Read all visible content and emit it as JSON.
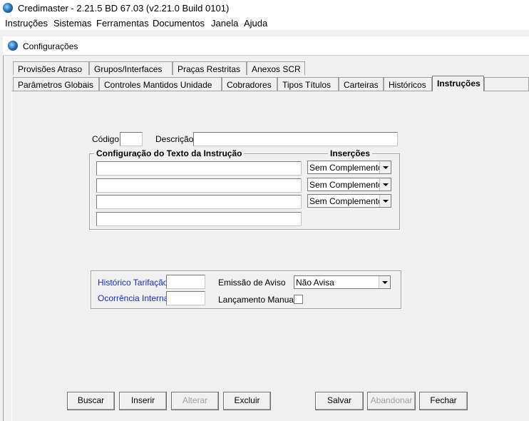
{
  "app": {
    "title": "Credimaster - 2.21.5 BD 67.03 (v2.21.0 Build 0101)"
  },
  "menu": {
    "items": [
      "Instruções",
      "Sistemas",
      "Ferramentas",
      "Documentos",
      "Janela",
      "Ajuda"
    ]
  },
  "window": {
    "title": "Configurações"
  },
  "tabs": {
    "row1": [
      "Provisões Atraso",
      "Grupos/Interfaces",
      "Praças Restritas",
      "Anexos SCR"
    ],
    "row2": [
      "Parâmetros Globais",
      "Controles Mantidos Unidade",
      "Cobradores",
      "Tipos Títulos",
      "Carteiras",
      "Históricos",
      "Instruções"
    ],
    "active": "Instruções"
  },
  "form": {
    "codigo_label": "Código",
    "codigo_value": "",
    "descricao_label": "Descrição",
    "descricao_value": ""
  },
  "config_texto": {
    "title": "Configuração do Texto da Instrução",
    "insercoes_title": "Inserções",
    "lines": [
      "",
      "",
      "",
      ""
    ],
    "insercoes": [
      "Sem Complemento",
      "Sem Complemento",
      "Sem Complemento"
    ]
  },
  "tarifacao": {
    "historico_label": "Histórico Tarifação",
    "historico_value": "",
    "ocorrencia_label": "Ocorrência Interna",
    "ocorrencia_value": "",
    "emissao_label": "Emissão de Aviso",
    "emissao_value": "Não Avisa",
    "lancamento_label": "Lançamento Manual",
    "lancamento_checked": false
  },
  "buttons": {
    "buscar": "Buscar",
    "inserir": "Inserir",
    "alterar": "Alterar",
    "excluir": "Excluir",
    "salvar": "Salvar",
    "abandonar": "Abandonar",
    "fechar": "Fechar"
  }
}
